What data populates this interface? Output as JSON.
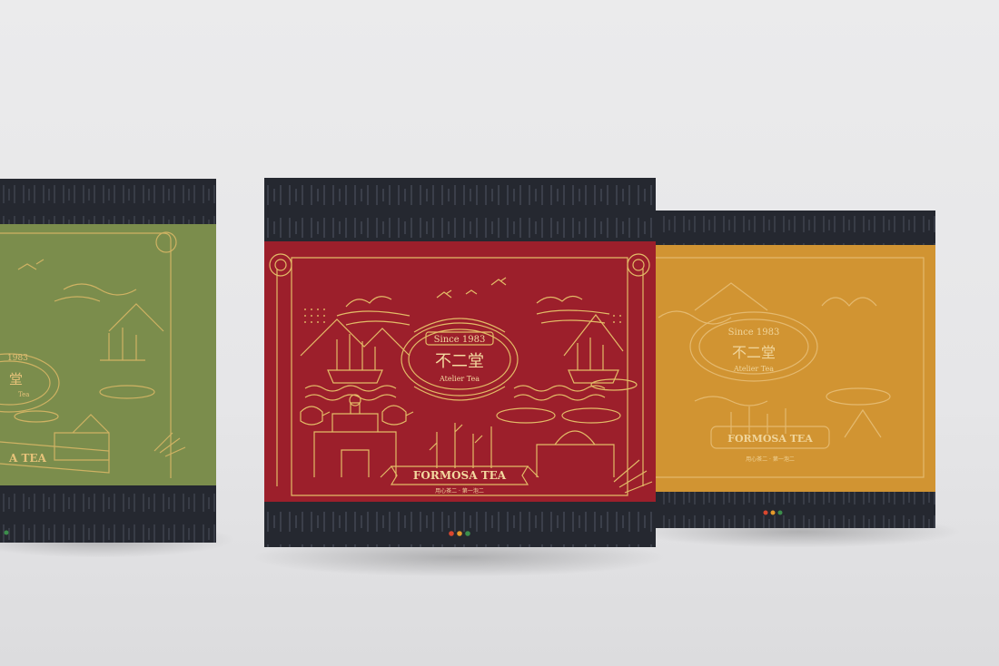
{
  "colors": {
    "box_dark": "#252830",
    "green_band": "#7b8d4c",
    "red_band": "#9c1f2b",
    "orange_band": "#d19432",
    "gold_line": "#e3bc67",
    "dot_red": "#d9472f",
    "dot_orange": "#e59a2b",
    "dot_green": "#3c8f4c"
  },
  "center_box": {
    "since": "Since 1983",
    "brand_cn": "不二堂",
    "brand_en": "Atelier Tea",
    "ribbon": "FORMOSA TEA",
    "motto": "用心茶二 · 第一泡二"
  },
  "right_box": {
    "since": "Since 1983",
    "brand_cn": "不二堂",
    "brand_en": "Atelier Tea",
    "ribbon": "FORMOSA TEA",
    "motto": "用心茶二 · 第一泡二"
  },
  "left_box": {
    "partial_label": "1983",
    "partial_brand": "堂",
    "partial_en": "Tea",
    "ribbon": "A TEA"
  }
}
